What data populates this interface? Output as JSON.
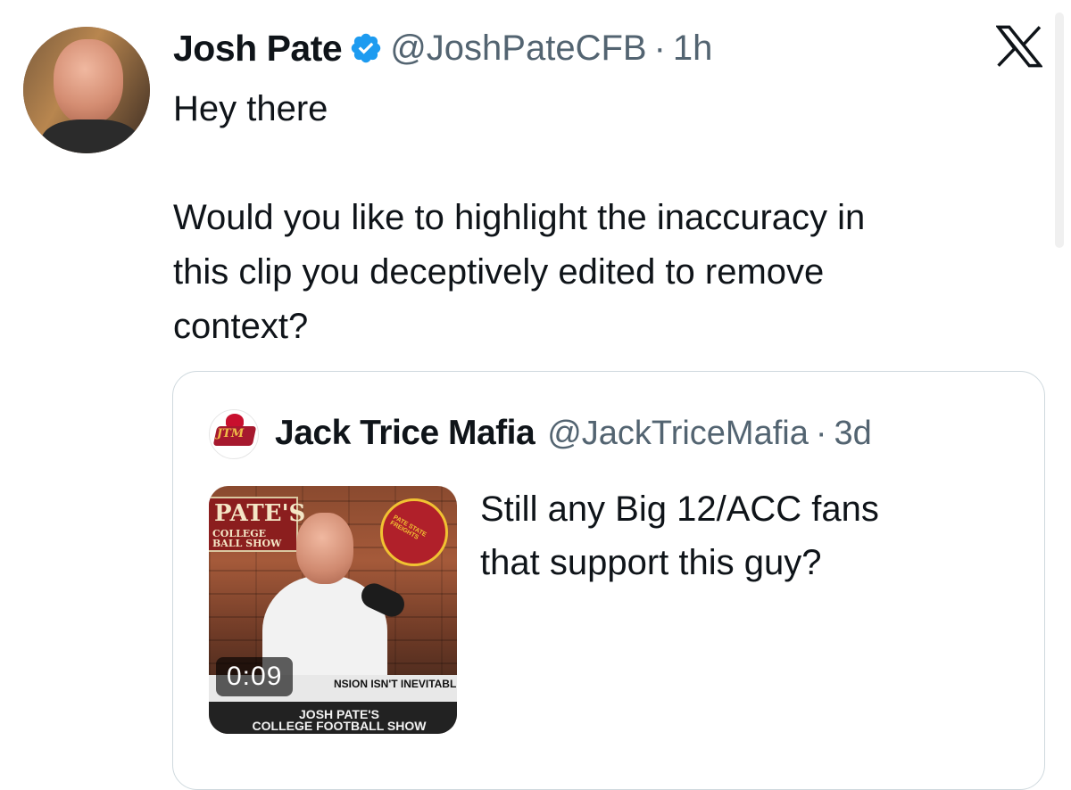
{
  "tweet": {
    "author": {
      "name": "Josh Pate",
      "handle": "@JoshPateCFB",
      "verified": true,
      "time": "1h",
      "separator": "·"
    },
    "text_lines": [
      "Hey there",
      "Would you like to highlight the inaccuracy in",
      "this clip you deceptively edited to remove",
      "context?"
    ],
    "platform_icon": "x-logo-icon",
    "verified_color": "#1d9bf0"
  },
  "quoted_tweet": {
    "author": {
      "name": "Jack Trice Mafia",
      "handle": "@JackTriceMafia",
      "time": "3d",
      "separator": "·",
      "avatar_text": "JTM"
    },
    "text_lines": [
      "Still any Big 12/ACC fans",
      "that support this guy?"
    ],
    "media": {
      "type": "video",
      "duration": "0:09",
      "sign_title": "PATE'S",
      "sign_sub_1": "COLLEGE",
      "sign_sub_2": "BALL SHOW",
      "badge_text": "PATE STATE FREIGHTS",
      "lower_third": "NSION ISN'T INEVITABLE",
      "show_title_1": "JOSH PATE'S",
      "show_title_2": "COLLEGE FOOTBALL SHOW"
    }
  }
}
